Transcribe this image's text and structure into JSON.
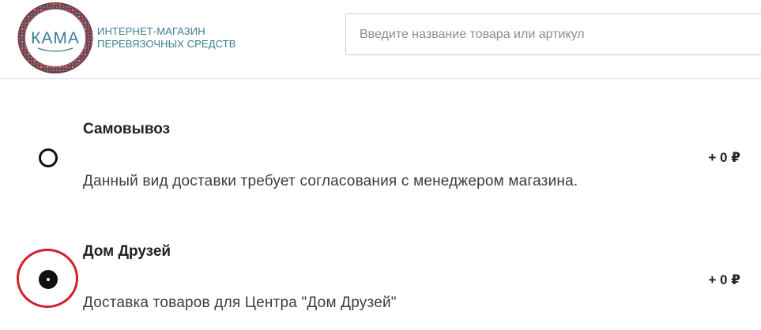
{
  "header": {
    "logo": {
      "brand": "КАМА",
      "tagline_line1": "Интернет-магазин",
      "tagline_line2": "перевязочных средств"
    },
    "search": {
      "placeholder": "Введите название товара или артикул",
      "value": ""
    }
  },
  "delivery_options": [
    {
      "title": "Самовывоз",
      "description": "Данный вид доставки требует согласования с менеджером магазина.",
      "price": "+ 0 ₽",
      "selected": false
    },
    {
      "title": "Дом Друзей",
      "description": "Доставка товаров для Центра \"Дом Друзей\"",
      "price": "+ 0 ₽",
      "selected": true
    }
  ],
  "colors": {
    "logo_text": "#3a7f91",
    "highlight_ring": "#d0202a",
    "radio": "#111111"
  }
}
